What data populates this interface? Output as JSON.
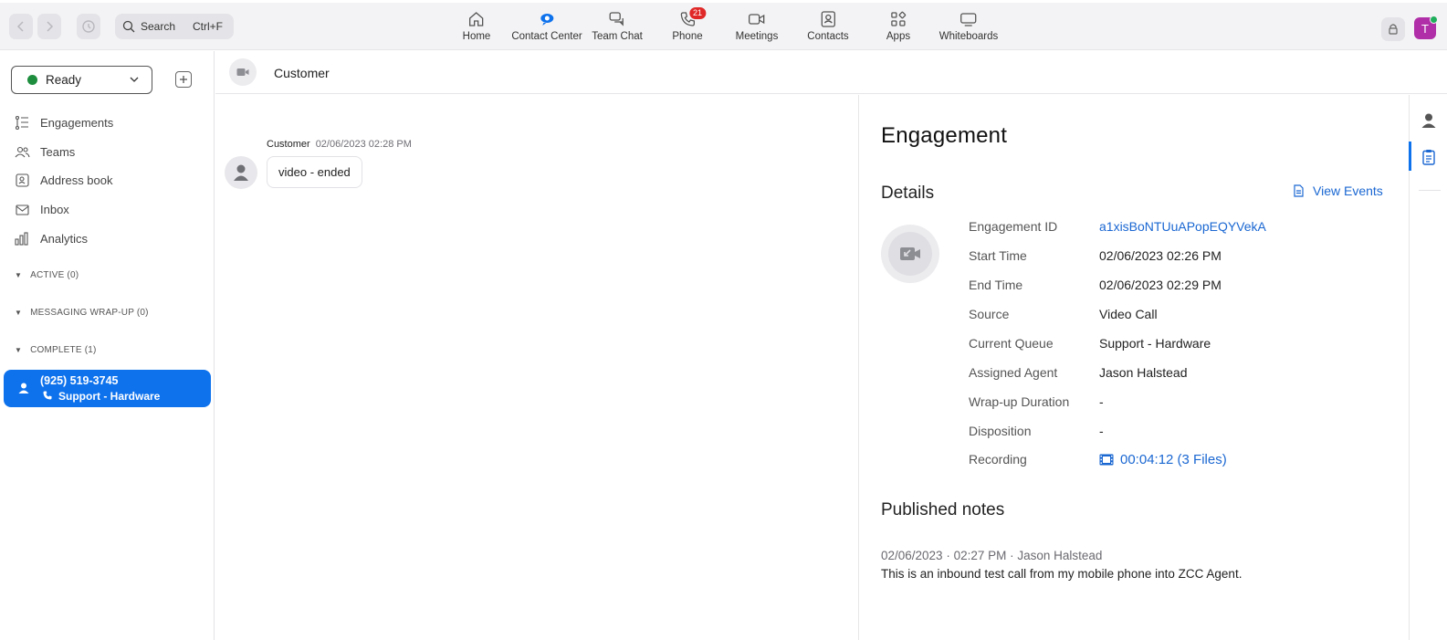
{
  "topbar": {
    "search_label": "Search",
    "search_shortcut": "Ctrl+F",
    "tabs": [
      {
        "label": "Home",
        "icon": "home-icon"
      },
      {
        "label": "Contact Center",
        "icon": "contact-center-icon"
      },
      {
        "label": "Team Chat",
        "icon": "team-chat-icon"
      },
      {
        "label": "Phone",
        "icon": "phone-icon",
        "badge": "21"
      },
      {
        "label": "Meetings",
        "icon": "meetings-icon"
      },
      {
        "label": "Contacts",
        "icon": "contacts-icon"
      },
      {
        "label": "Apps",
        "icon": "apps-icon"
      },
      {
        "label": "Whiteboards",
        "icon": "whiteboards-icon"
      }
    ],
    "avatar_initial": "T"
  },
  "sidebar": {
    "status": "Ready",
    "nav": [
      {
        "label": "Engagements",
        "icon": "engagements-icon"
      },
      {
        "label": "Teams",
        "icon": "teams-icon"
      },
      {
        "label": "Address book",
        "icon": "address-book-icon"
      },
      {
        "label": "Inbox",
        "icon": "inbox-icon"
      },
      {
        "label": "Analytics",
        "icon": "analytics-icon"
      }
    ],
    "sections": [
      {
        "label": "ACTIVE (0)"
      },
      {
        "label": "MESSAGING WRAP-UP (0)"
      },
      {
        "label": "COMPLETE (1)"
      }
    ],
    "engagement": {
      "phone": "(925) 519-3745",
      "queue": "Support - Hardware"
    }
  },
  "conversation": {
    "title": "Customer",
    "message": {
      "sender": "Customer",
      "timestamp": "02/06/2023 02:28 PM",
      "text": "video - ended"
    }
  },
  "engagement_panel": {
    "title": "Engagement",
    "details_heading": "Details",
    "view_events": "View Events",
    "details": [
      {
        "key": "Engagement ID",
        "value": "a1xisBoNTUuAPopEQYVekA"
      },
      {
        "key": "Start Time",
        "value": "02/06/2023 02:26 PM"
      },
      {
        "key": "End Time",
        "value": "02/06/2023 02:29 PM"
      },
      {
        "key": "Source",
        "value": "Video Call"
      },
      {
        "key": "Current Queue",
        "value": "Support - Hardware"
      },
      {
        "key": "Assigned Agent",
        "value": "Jason Halstead"
      },
      {
        "key": "Wrap-up Duration",
        "value": "-"
      },
      {
        "key": "Disposition",
        "value": "-"
      },
      {
        "key": "Recording",
        "value": "00:04:12 (3 Files)"
      }
    ],
    "notes_heading": "Published notes",
    "note": {
      "meta": "02/06/2023 · 02:27 PM · Jason Halstead",
      "text": "This is an inbound test call from my mobile phone into ZCC Agent."
    }
  },
  "colors": {
    "accent": "#0e72ed",
    "link": "#1a67d2",
    "ready": "#1e8e3e",
    "badge": "#e02828"
  }
}
